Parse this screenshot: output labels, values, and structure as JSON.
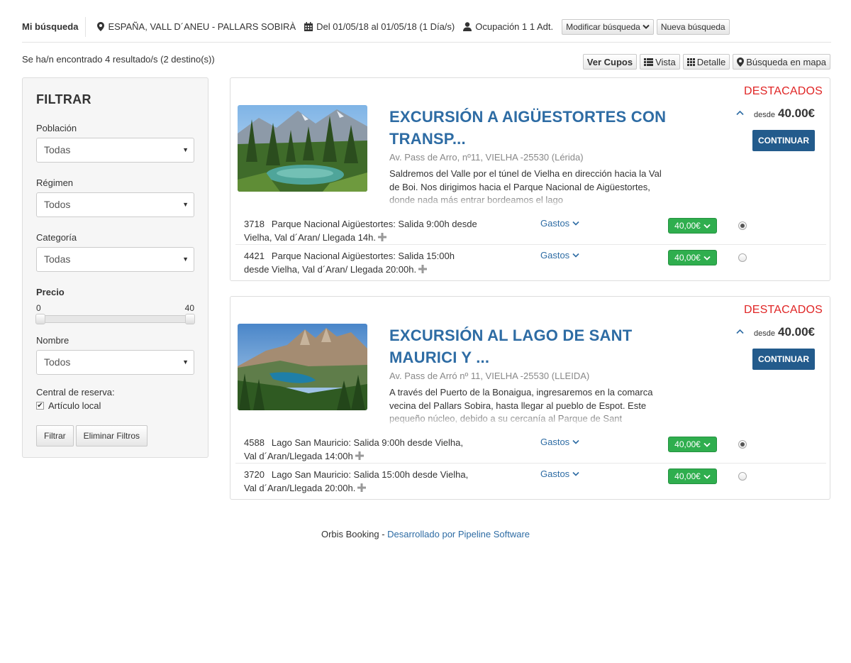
{
  "search": {
    "title": "Mi búsqueda",
    "location": "ESPAÑA, VALL D´ANEU - PALLARS SOBIRÀ",
    "dates": "Del 01/05/18 al 01/05/18 (1 Día/s)",
    "occupancy": "Ocupación 1 1 Adt.",
    "modify_label": "Modificar búsqueda",
    "new_label": "Nueva búsqueda"
  },
  "results_text": "Se ha/n encontrado 4 resultado/s (2 destino(s))",
  "view_buttons": {
    "ver_cupos": "Ver Cupos",
    "vista": "Vista",
    "detalle": "Detalle",
    "mapa": "Búsqueda en mapa"
  },
  "filter": {
    "title": "FILTRAR",
    "poblacion": {
      "label": "Población",
      "value": "Todas"
    },
    "regimen": {
      "label": "Régimen",
      "value": "Todos"
    },
    "categoria": {
      "label": "Categoría",
      "value": "Todas"
    },
    "precio": {
      "label": "Precio",
      "min": "0",
      "max": "40"
    },
    "nombre": {
      "label": "Nombre",
      "value": "Todos"
    },
    "central": {
      "label": "Central de reserva:",
      "option": "Artículo local",
      "checked": true
    },
    "filtrar_label": "Filtrar",
    "eliminar_label": "Eliminar Filtros"
  },
  "cards": [
    {
      "badge": "DESTACADOS",
      "title": "EXCURSIÓN A AIGÜESTORTES CON TRANSP...",
      "address": "Av. Pass de Arro, nº11, VIELHA -25530 (Lérida)",
      "description": "Saldremos del Valle por el túnel de Vielha en dirección hacia la Val de Boi. Nos dirigimos hacia el Parque Nacional de Aigüestortes, donde nada más entrar bordeamos el lago",
      "desde": "desde",
      "price": "40.00€",
      "continue_label": "CONTINUAR",
      "rows": [
        {
          "code": "3718",
          "text": "Parque Nacional Aigüestortes: Salida 9:00h desde Vielha, Val d´Aran/ Llegada 14h.",
          "gastos": "Gastos",
          "price": "40,00€",
          "selected": true
        },
        {
          "code": "4421",
          "text": "Parque Nacional Aigüestortes: Salida 15:00h desde Vielha, Val d´Aran/ Llegada 20:00h.",
          "gastos": "Gastos",
          "price": "40,00€",
          "selected": false
        }
      ]
    },
    {
      "badge": "DESTACADOS",
      "title": "EXCURSIÓN AL LAGO DE SANT MAURICI Y ...",
      "address": "Av. Pass de Arró nº 11, VIELHA -25530 (LLEIDA)",
      "description": "A través del Puerto de la Bonaigua, ingresaremos en la comarca vecina del Pallars Sobira, hasta llegar al pueblo de Espot. Este pequeño núcleo, debido a su cercanía al Parque de Sant",
      "desde": "desde",
      "price": "40.00€",
      "continue_label": "CONTINUAR",
      "rows": [
        {
          "code": "4588",
          "text": "Lago San Mauricio: Salida 9:00h desde Vielha, Val d´Aran/Llegada 14:00h",
          "gastos": "Gastos",
          "price": "40,00€",
          "selected": true
        },
        {
          "code": "3720",
          "text": "Lago San Mauricio: Salida 15:00h desde Vielha, Val d´Aran/Llegada 20:00h.",
          "gastos": "Gastos",
          "price": "40,00€",
          "selected": false
        }
      ]
    }
  ],
  "footer": {
    "brand": "Orbis Booking - ",
    "link": "Desarrollado por Pipeline Software"
  },
  "colors": {
    "link_blue": "#2e6ca4",
    "badge_red": "#e02525",
    "continue_blue": "#235b8c",
    "price_green": "#2fae4e"
  },
  "icons": [
    "map-marker-icon",
    "calendar-icon",
    "user-icon",
    "chevron-down-icon",
    "list-icon",
    "grid-icon",
    "plus-icon",
    "chevron-up-icon"
  ]
}
